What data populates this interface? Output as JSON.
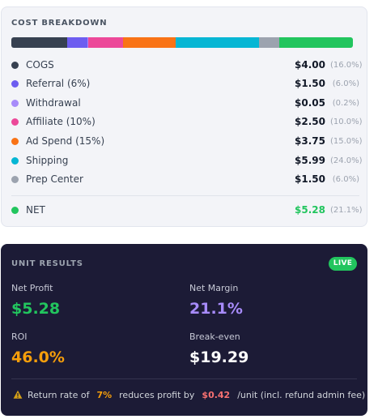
{
  "cost_breakdown": {
    "title": "COST BREAKDOWN",
    "items": [
      {
        "label": "COGS",
        "value": "$4.00",
        "pct": "(16.0%)",
        "share": 16.0,
        "color": "#374151"
      },
      {
        "label": "Referral (6%)",
        "value": "$1.50",
        "pct": "(6.0%)",
        "share": 6.0,
        "color": "#6d5df0"
      },
      {
        "label": "Withdrawal",
        "value": "$0.05",
        "pct": "(0.2%)",
        "share": 0.2,
        "color": "#a78bfa"
      },
      {
        "label": "Affiliate (10%)",
        "value": "$2.50",
        "pct": "(10.0%)",
        "share": 10.0,
        "color": "#ec4899"
      },
      {
        "label": "Ad Spend (15%)",
        "value": "$3.75",
        "pct": "(15.0%)",
        "share": 15.0,
        "color": "#f97316"
      },
      {
        "label": "Shipping",
        "value": "$5.99",
        "pct": "(24.0%)",
        "share": 24.0,
        "color": "#06b6d4"
      },
      {
        "label": "Prep Center",
        "value": "$1.50",
        "pct": "(6.0%)",
        "share": 6.0,
        "color": "#9ca3af"
      }
    ],
    "net": {
      "label": "NET",
      "value": "$5.28",
      "pct": "(21.1%)",
      "share": 21.1,
      "color": "#22c55e"
    }
  },
  "unit_results": {
    "title": "UNIT RESULTS",
    "badge": "LIVE",
    "net_profit_label": "Net Profit",
    "net_profit_value": "$5.28",
    "net_margin_label": "Net Margin",
    "net_margin_value": "21.1%",
    "roi_label": "ROI",
    "roi_value": "46.0%",
    "breakeven_label": "Break-even",
    "breakeven_value": "$19.29",
    "colors": {
      "net_profit": "#22c55e",
      "net_margin": "#a78bfa",
      "roi": "#f59e0b",
      "breakeven": "#ffffff"
    },
    "note": {
      "icon": "warning-icon",
      "prefix": "Return rate of",
      "rate": "7%",
      "middle": "reduces profit by",
      "amount": "$0.42",
      "suffix": "/unit (incl. refund admin fee)"
    }
  }
}
